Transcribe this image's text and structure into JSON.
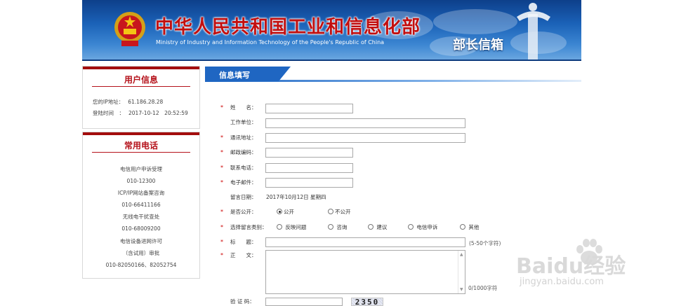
{
  "header": {
    "title_cn": "中华人民共和国工业和信息化部",
    "title_en": "Ministry of Industry and Information Technology of the People's Republic of China",
    "mailbox_label": "部长信箱"
  },
  "user_info": {
    "title": "用户信息",
    "ip_label": "您的IP地址：",
    "ip_value": "61.186.28.28",
    "login_label": "登陆时间　：",
    "login_value": "2017-10-12　20:52:59"
  },
  "phones": {
    "title": "常用电话",
    "lines": [
      "电信用户申诉受理",
      "010-12300",
      "ICP/IP网站备案咨询",
      "010-66411166",
      "无线电干扰查处",
      "010-68009200",
      "电信设备进网许可",
      "（含试用）审批",
      "010-82050166、82052754"
    ]
  },
  "section": {
    "tab_label": "信息填写"
  },
  "form": {
    "required_mark": "*",
    "name_label": "姓　　名：",
    "company_label": "工作单位：",
    "address_label": "通讯地址：",
    "postcode_label": "邮政编码：",
    "phone_label": "联系电话：",
    "email_label": "电子邮件：",
    "date_label": "留言日期：",
    "date_value": "2017年10月12日 星期四",
    "public_label": "是否公开：",
    "public_options": [
      "公开",
      "不公开"
    ],
    "category_label": "选择留言类别：",
    "category_options": [
      "反映问题",
      "咨询",
      "建议",
      "电信申诉",
      "其他"
    ],
    "subject_label": "标　　题：",
    "subject_hint": "(5-50个字符)",
    "body_label": "正　　文：",
    "body_counter": "0/1000字符",
    "captcha_label": "验 证 码：",
    "captcha_value": "2350"
  },
  "watermark": {
    "brand": "Baidu经验",
    "sub": "jingyan.baidu.com"
  },
  "colors": {
    "brand_red": "#b5121b",
    "banner_blue": "#1b62b8",
    "tab_blue": "#1f66c2"
  }
}
